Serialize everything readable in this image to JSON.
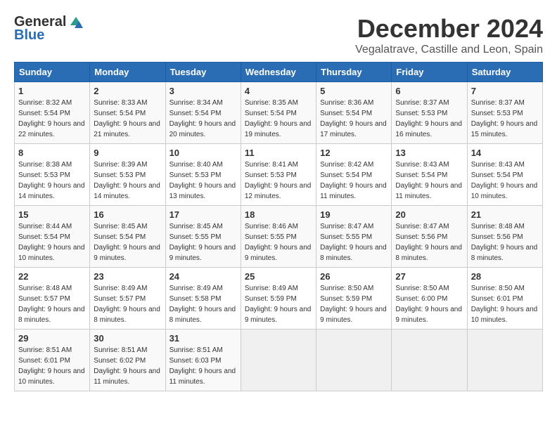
{
  "header": {
    "logo_general": "General",
    "logo_blue": "Blue",
    "month": "December 2024",
    "location": "Vegalatrave, Castille and Leon, Spain"
  },
  "weekdays": [
    "Sunday",
    "Monday",
    "Tuesday",
    "Wednesday",
    "Thursday",
    "Friday",
    "Saturday"
  ],
  "weeks": [
    [
      {
        "day": "1",
        "sunrise": "Sunrise: 8:32 AM",
        "sunset": "Sunset: 5:54 PM",
        "daylight": "Daylight: 9 hours and 22 minutes."
      },
      {
        "day": "2",
        "sunrise": "Sunrise: 8:33 AM",
        "sunset": "Sunset: 5:54 PM",
        "daylight": "Daylight: 9 hours and 21 minutes."
      },
      {
        "day": "3",
        "sunrise": "Sunrise: 8:34 AM",
        "sunset": "Sunset: 5:54 PM",
        "daylight": "Daylight: 9 hours and 20 minutes."
      },
      {
        "day": "4",
        "sunrise": "Sunrise: 8:35 AM",
        "sunset": "Sunset: 5:54 PM",
        "daylight": "Daylight: 9 hours and 19 minutes."
      },
      {
        "day": "5",
        "sunrise": "Sunrise: 8:36 AM",
        "sunset": "Sunset: 5:54 PM",
        "daylight": "Daylight: 9 hours and 17 minutes."
      },
      {
        "day": "6",
        "sunrise": "Sunrise: 8:37 AM",
        "sunset": "Sunset: 5:53 PM",
        "daylight": "Daylight: 9 hours and 16 minutes."
      },
      {
        "day": "7",
        "sunrise": "Sunrise: 8:37 AM",
        "sunset": "Sunset: 5:53 PM",
        "daylight": "Daylight: 9 hours and 15 minutes."
      }
    ],
    [
      {
        "day": "8",
        "sunrise": "Sunrise: 8:38 AM",
        "sunset": "Sunset: 5:53 PM",
        "daylight": "Daylight: 9 hours and 14 minutes."
      },
      {
        "day": "9",
        "sunrise": "Sunrise: 8:39 AM",
        "sunset": "Sunset: 5:53 PM",
        "daylight": "Daylight: 9 hours and 14 minutes."
      },
      {
        "day": "10",
        "sunrise": "Sunrise: 8:40 AM",
        "sunset": "Sunset: 5:53 PM",
        "daylight": "Daylight: 9 hours and 13 minutes."
      },
      {
        "day": "11",
        "sunrise": "Sunrise: 8:41 AM",
        "sunset": "Sunset: 5:53 PM",
        "daylight": "Daylight: 9 hours and 12 minutes."
      },
      {
        "day": "12",
        "sunrise": "Sunrise: 8:42 AM",
        "sunset": "Sunset: 5:54 PM",
        "daylight": "Daylight: 9 hours and 11 minutes."
      },
      {
        "day": "13",
        "sunrise": "Sunrise: 8:43 AM",
        "sunset": "Sunset: 5:54 PM",
        "daylight": "Daylight: 9 hours and 11 minutes."
      },
      {
        "day": "14",
        "sunrise": "Sunrise: 8:43 AM",
        "sunset": "Sunset: 5:54 PM",
        "daylight": "Daylight: 9 hours and 10 minutes."
      }
    ],
    [
      {
        "day": "15",
        "sunrise": "Sunrise: 8:44 AM",
        "sunset": "Sunset: 5:54 PM",
        "daylight": "Daylight: 9 hours and 10 minutes."
      },
      {
        "day": "16",
        "sunrise": "Sunrise: 8:45 AM",
        "sunset": "Sunset: 5:54 PM",
        "daylight": "Daylight: 9 hours and 9 minutes."
      },
      {
        "day": "17",
        "sunrise": "Sunrise: 8:45 AM",
        "sunset": "Sunset: 5:55 PM",
        "daylight": "Daylight: 9 hours and 9 minutes."
      },
      {
        "day": "18",
        "sunrise": "Sunrise: 8:46 AM",
        "sunset": "Sunset: 5:55 PM",
        "daylight": "Daylight: 9 hours and 9 minutes."
      },
      {
        "day": "19",
        "sunrise": "Sunrise: 8:47 AM",
        "sunset": "Sunset: 5:55 PM",
        "daylight": "Daylight: 9 hours and 8 minutes."
      },
      {
        "day": "20",
        "sunrise": "Sunrise: 8:47 AM",
        "sunset": "Sunset: 5:56 PM",
        "daylight": "Daylight: 9 hours and 8 minutes."
      },
      {
        "day": "21",
        "sunrise": "Sunrise: 8:48 AM",
        "sunset": "Sunset: 5:56 PM",
        "daylight": "Daylight: 9 hours and 8 minutes."
      }
    ],
    [
      {
        "day": "22",
        "sunrise": "Sunrise: 8:48 AM",
        "sunset": "Sunset: 5:57 PM",
        "daylight": "Daylight: 9 hours and 8 minutes."
      },
      {
        "day": "23",
        "sunrise": "Sunrise: 8:49 AM",
        "sunset": "Sunset: 5:57 PM",
        "daylight": "Daylight: 9 hours and 8 minutes."
      },
      {
        "day": "24",
        "sunrise": "Sunrise: 8:49 AM",
        "sunset": "Sunset: 5:58 PM",
        "daylight": "Daylight: 9 hours and 8 minutes."
      },
      {
        "day": "25",
        "sunrise": "Sunrise: 8:49 AM",
        "sunset": "Sunset: 5:59 PM",
        "daylight": "Daylight: 9 hours and 9 minutes."
      },
      {
        "day": "26",
        "sunrise": "Sunrise: 8:50 AM",
        "sunset": "Sunset: 5:59 PM",
        "daylight": "Daylight: 9 hours and 9 minutes."
      },
      {
        "day": "27",
        "sunrise": "Sunrise: 8:50 AM",
        "sunset": "Sunset: 6:00 PM",
        "daylight": "Daylight: 9 hours and 9 minutes."
      },
      {
        "day": "28",
        "sunrise": "Sunrise: 8:50 AM",
        "sunset": "Sunset: 6:01 PM",
        "daylight": "Daylight: 9 hours and 10 minutes."
      }
    ],
    [
      {
        "day": "29",
        "sunrise": "Sunrise: 8:51 AM",
        "sunset": "Sunset: 6:01 PM",
        "daylight": "Daylight: 9 hours and 10 minutes."
      },
      {
        "day": "30",
        "sunrise": "Sunrise: 8:51 AM",
        "sunset": "Sunset: 6:02 PM",
        "daylight": "Daylight: 9 hours and 11 minutes."
      },
      {
        "day": "31",
        "sunrise": "Sunrise: 8:51 AM",
        "sunset": "Sunset: 6:03 PM",
        "daylight": "Daylight: 9 hours and 11 minutes."
      },
      null,
      null,
      null,
      null
    ]
  ]
}
